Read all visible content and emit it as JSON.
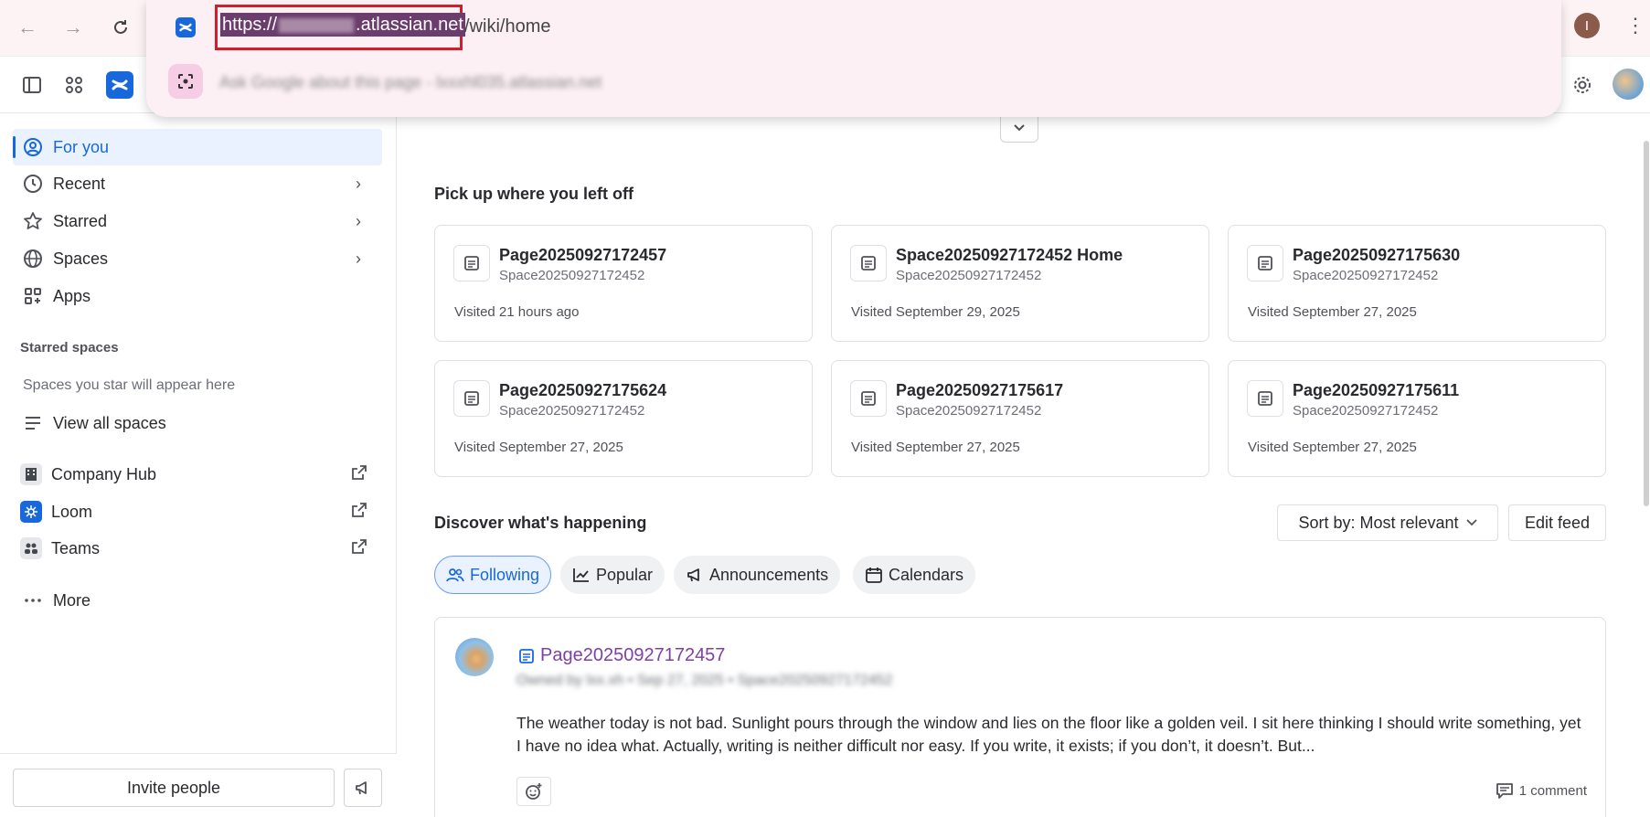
{
  "browser": {
    "url_selected": "https://",
    "url_domain": ".atlassian.net",
    "url_path": "/wiki/home",
    "suggestion": "Ask Google about this page - lxxxhl035.atlassian.net",
    "profile_initial": "I"
  },
  "sidebar": {
    "nav": [
      {
        "label": "For you",
        "icon": "user-circle-icon",
        "active": true
      },
      {
        "label": "Recent",
        "icon": "clock-icon",
        "active": false
      },
      {
        "label": "Starred",
        "icon": "star-icon",
        "active": false
      },
      {
        "label": "Spaces",
        "icon": "globe-icon",
        "active": false
      },
      {
        "label": "Apps",
        "icon": "apps-icon",
        "active": false
      }
    ],
    "starred_heading": "Starred spaces",
    "starred_empty": "Spaces you star will appear here",
    "view_all": "View all spaces",
    "external": [
      {
        "label": "Company Hub",
        "icon": "building-icon"
      },
      {
        "label": "Loom",
        "icon": "loom-icon"
      },
      {
        "label": "Teams",
        "icon": "teams-icon"
      }
    ],
    "more": "More",
    "invite": "Invite people"
  },
  "main": {
    "pickup_title": "Pick up where you left off",
    "cards": [
      {
        "title": "Page20250927172457",
        "space": "Space20250927172452",
        "visited": "Visited 21 hours ago"
      },
      {
        "title": "Space20250927172452 Home",
        "space": "Space20250927172452",
        "visited": "Visited September 29, 2025"
      },
      {
        "title": "Page20250927175630",
        "space": "Space20250927172452",
        "visited": "Visited September 27, 2025"
      },
      {
        "title": "Page20250927175624",
        "space": "Space20250927172452",
        "visited": "Visited September 27, 2025"
      },
      {
        "title": "Page20250927175617",
        "space": "Space20250927172452",
        "visited": "Visited September 27, 2025"
      },
      {
        "title": "Page20250927175611",
        "space": "Space20250927172452",
        "visited": "Visited September 27, 2025"
      }
    ],
    "discover_title": "Discover what's happening",
    "sort_label": "Sort by: Most relevant",
    "edit_feed": "Edit feed",
    "tabs": [
      {
        "label": "Following",
        "icon": "people-icon",
        "active": true
      },
      {
        "label": "Popular",
        "icon": "trending-icon",
        "active": false
      },
      {
        "label": "Announcements",
        "icon": "megaphone-icon",
        "active": false
      },
      {
        "label": "Calendars",
        "icon": "calendar-icon",
        "active": false
      }
    ],
    "feed": {
      "title": "Page20250927172457",
      "meta": "Owned by lxx.xh • Sep 27, 2025 • Space20250927172452",
      "body": "The weather today is not bad. Sunlight pours through the window and lies on the floor like a golden veil. I sit here thinking I should write something, yet I have no idea what. Actually, writing is neither difficult nor easy. If you write, it exists; if you don’t, it doesn’t. But...",
      "comments": "1 comment"
    }
  },
  "colors": {
    "accent": "#1868db",
    "highlight": "#d51d2a",
    "link_purple": "#803fa5"
  }
}
